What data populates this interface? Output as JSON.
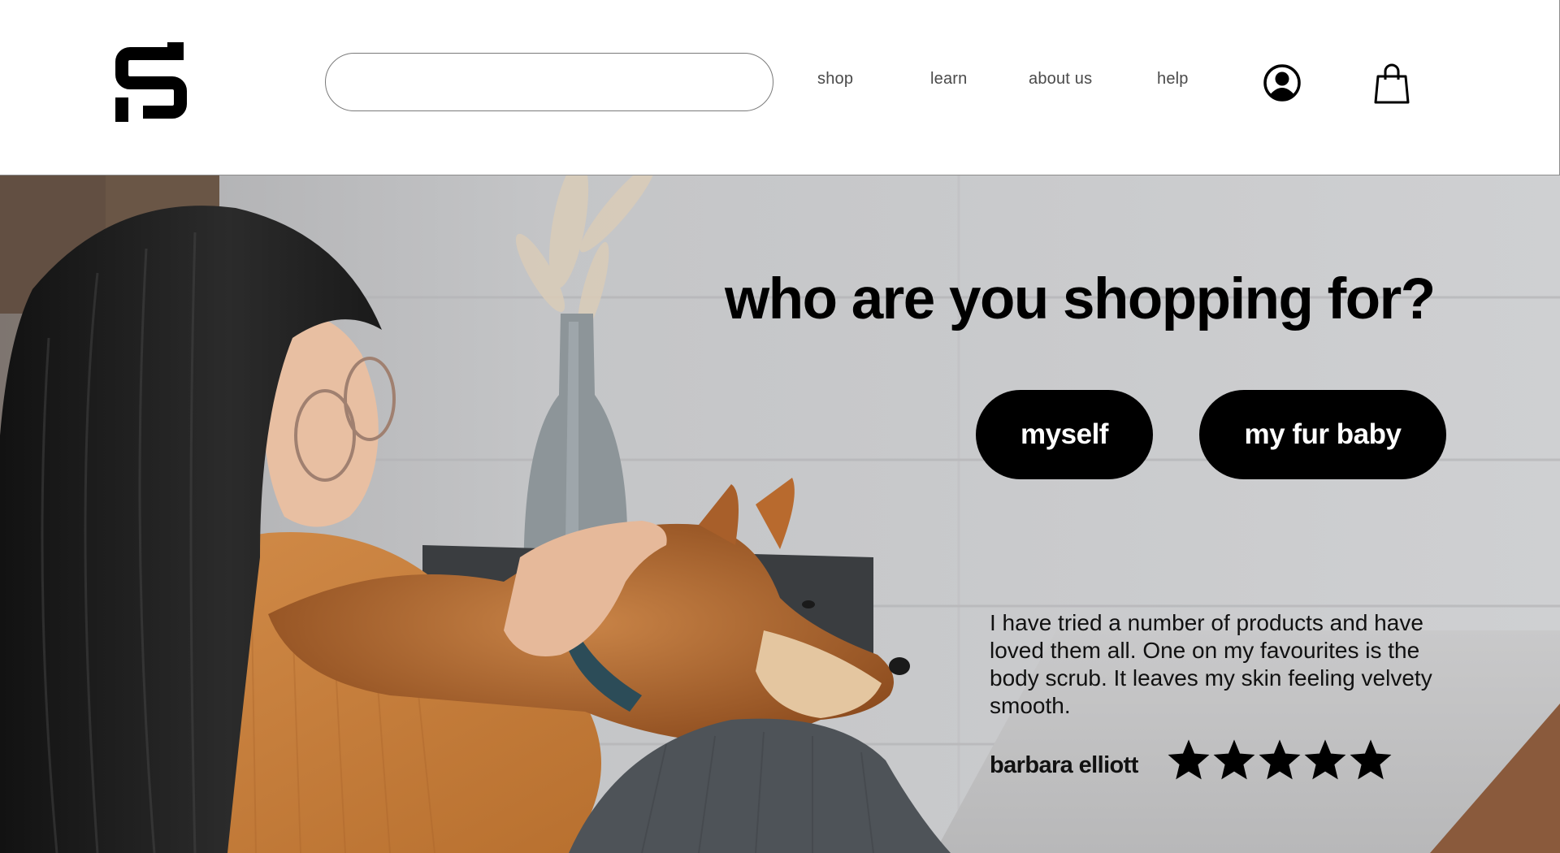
{
  "header": {
    "logo_icon": "brand-logo-icon",
    "search": {
      "value": "",
      "placeholder": ""
    },
    "nav": [
      {
        "label": "shop"
      },
      {
        "label": "learn"
      },
      {
        "label": "about us"
      },
      {
        "label": "help"
      }
    ],
    "account_icon": "user-circle-icon",
    "cart_icon": "shopping-bag-icon"
  },
  "hero": {
    "image": "woman-petting-shiba-inu-photo",
    "headline": "who are you shopping for?",
    "buttons": [
      {
        "label": "myself"
      },
      {
        "label": "my fur baby"
      }
    ],
    "testimonial": {
      "quote": "I have tried a number of products and have loved them all.  One on my favourites is the body scrub. It leaves my skin feeling velvety smooth.",
      "author": "barbara elliott",
      "rating": 5,
      "rating_max": 5
    }
  },
  "colors": {
    "accent": "#000000",
    "button_text": "#ffffff",
    "nav_text": "#4a4a4a",
    "background": "#ffffff"
  }
}
